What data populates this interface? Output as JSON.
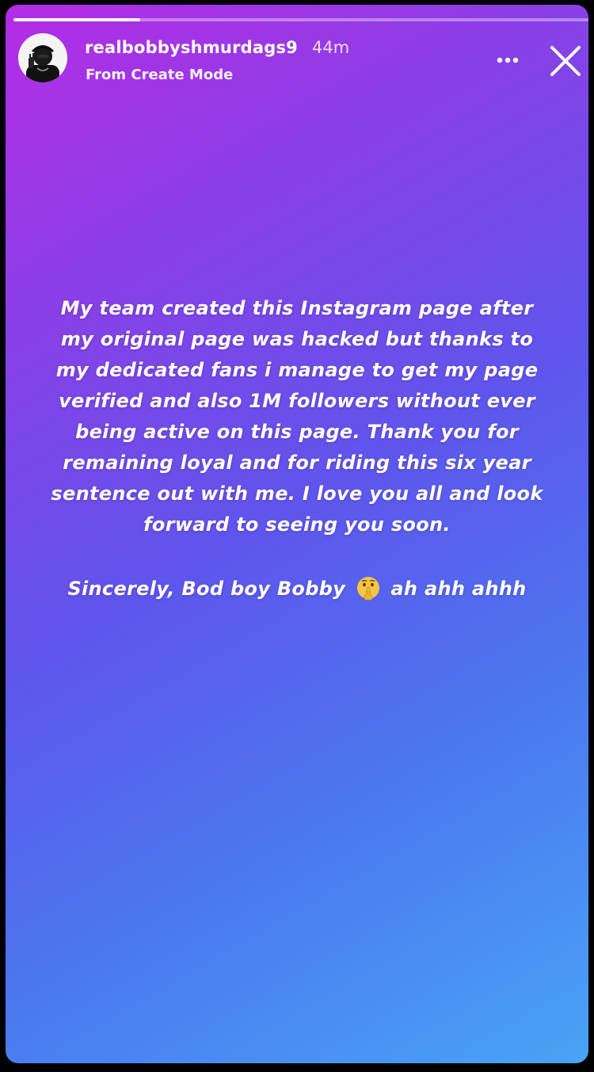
{
  "story": {
    "progress": 0.22,
    "progress_color": "#ffffff"
  },
  "header": {
    "username": "realbobbyshmurdags9",
    "timestamp": "44m",
    "subtitle": "From Create Mode",
    "avatar_icon": "profile-photo-icon",
    "more_icon": "more-options-icon",
    "close_icon": "close-icon"
  },
  "content": {
    "message_lines": [
      "My team created this Instagram page after",
      "my original page was hacked but thanks to",
      "my dedicated fans i manage to get my page",
      "verified and also 1M followers without ever",
      "being active on this page. Thank you for",
      "remaining loyal and for riding this six year",
      "sentence out with me. I love you all and look",
      "forward to seeing you soon."
    ],
    "signoff_before": "Sincerely, Bod boy Bobby",
    "signoff_emoji": "shushing-face-icon",
    "signoff_after": "ah ahh ahhh"
  },
  "colors": {
    "gradient_top_left": "#b52ce6",
    "gradient_middle": "#5f55ec",
    "gradient_bottom_right": "#49a3f5",
    "text": "#ffffff"
  }
}
